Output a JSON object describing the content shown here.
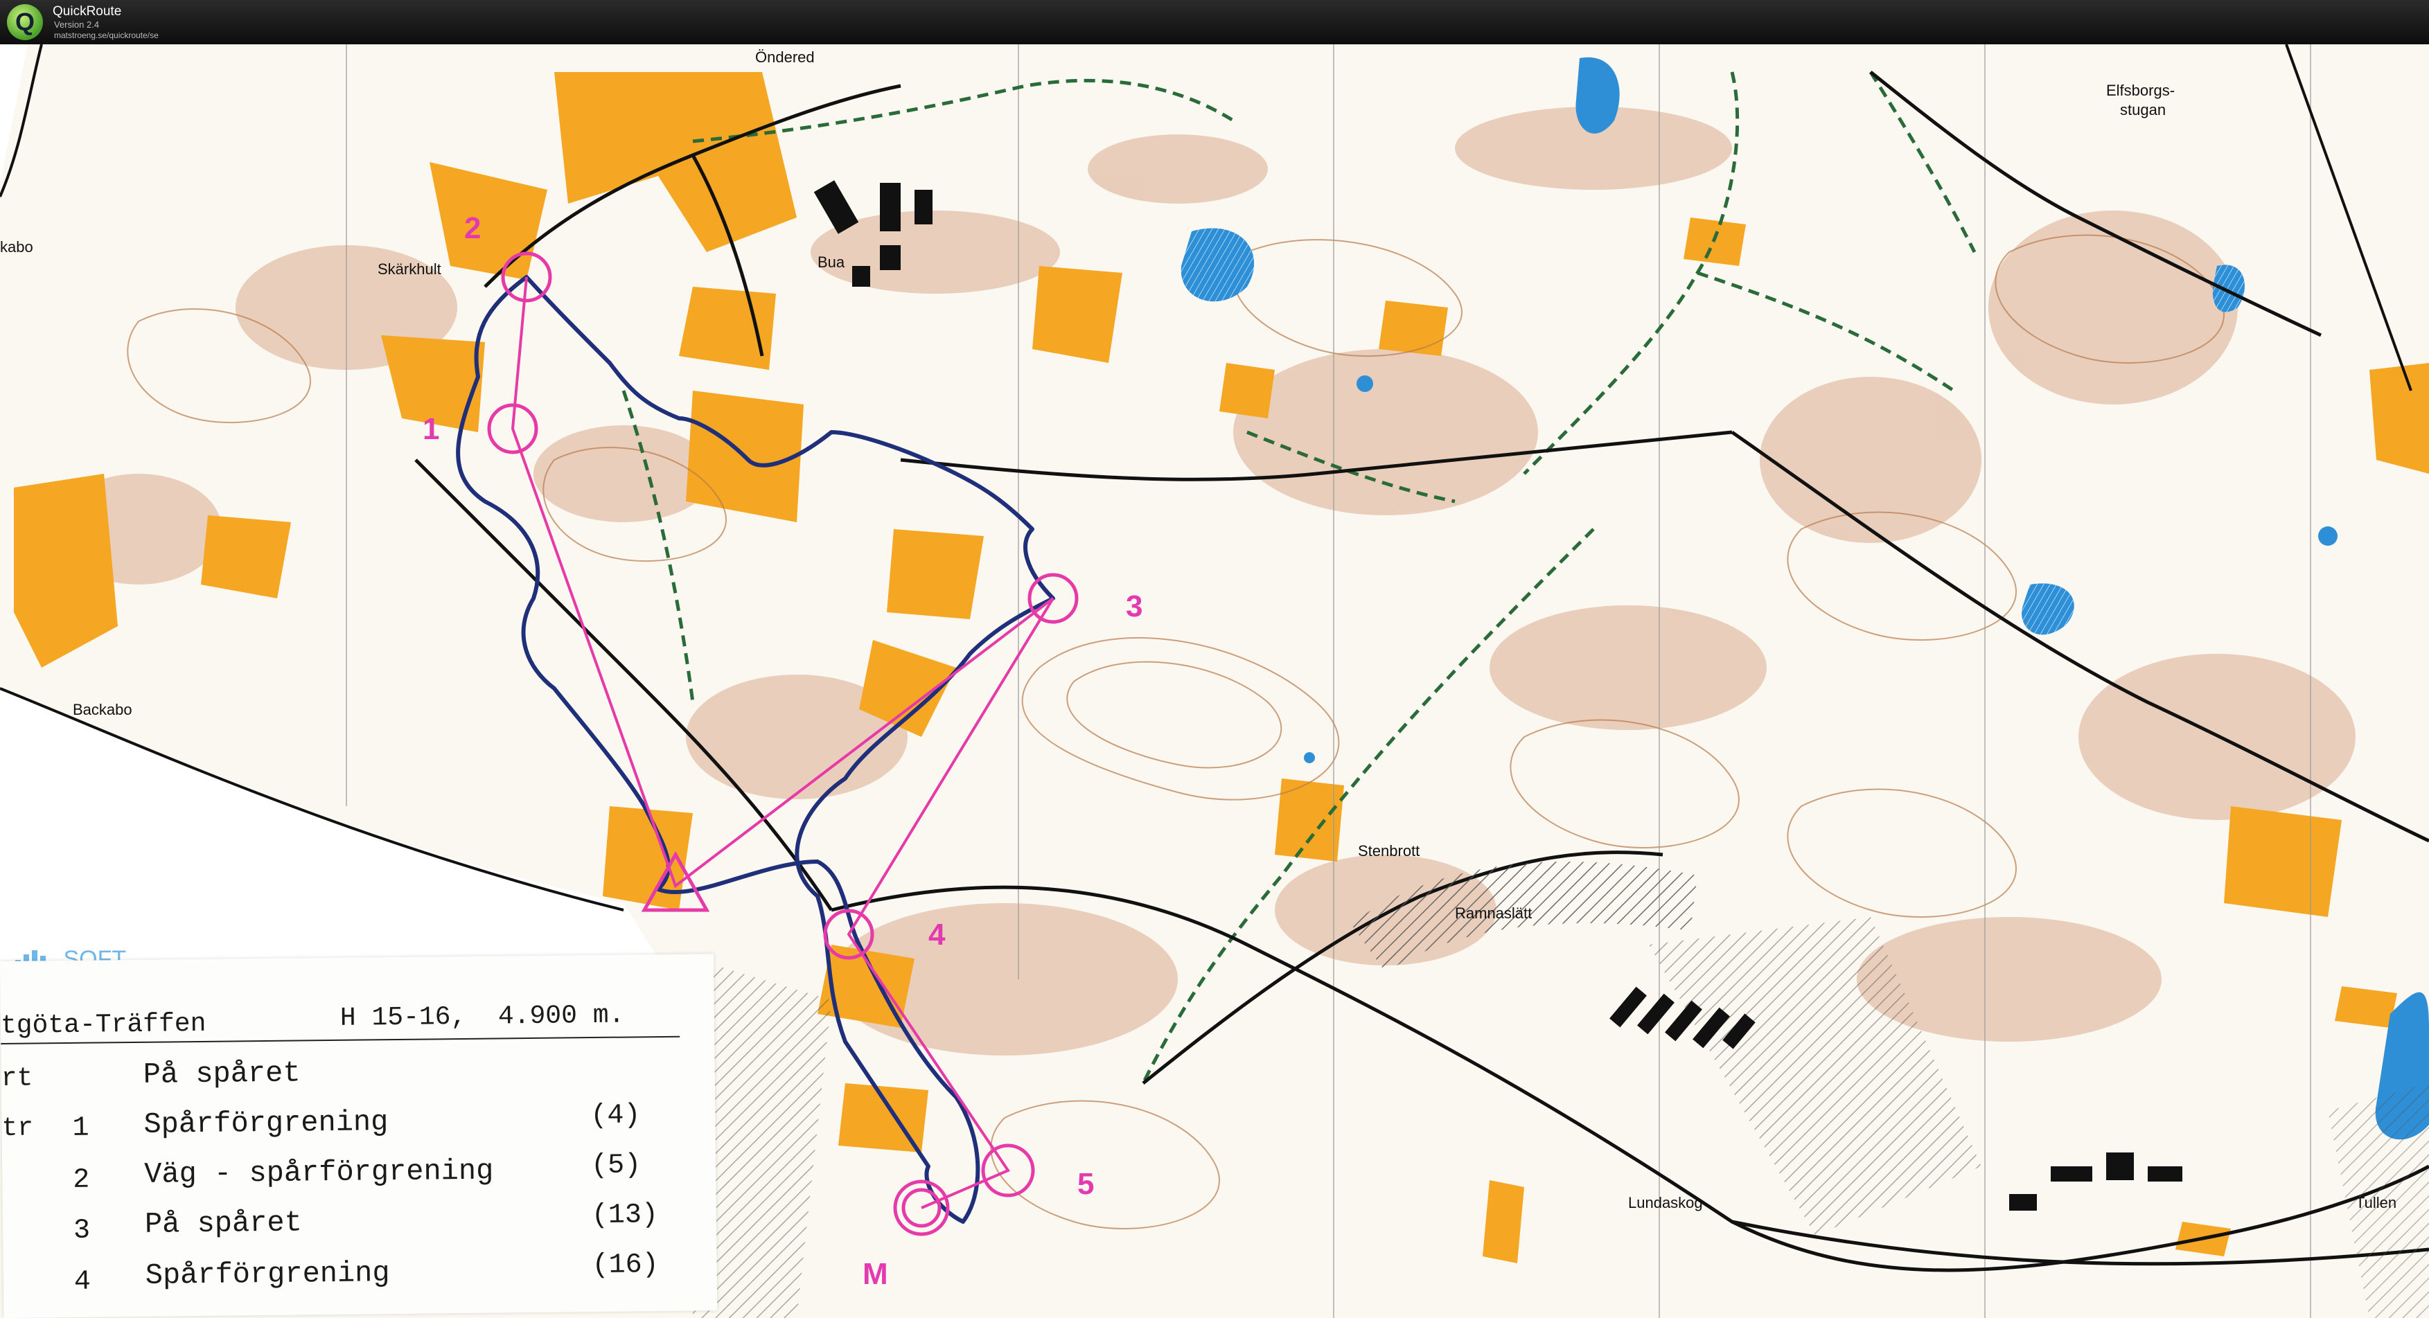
{
  "window": {
    "title": "QuickRoute",
    "version": "Version 2.4",
    "url": "matstroeng.se/quickroute/se",
    "icon": "quickroute-logo-icon"
  },
  "map": {
    "places": {
      "ondered": "Öndered",
      "skarkhult": "Skärkhult",
      "bua": "Bua",
      "kabo": "kabo",
      "backabo": "Backabo",
      "elfsborgs": "Elfsborgs-",
      "stugan": "stugan",
      "stenbrott": "Stenbrott",
      "ramnaslatt": "Ramnaslätt",
      "lundaskog": "Lundaskog",
      "tullen": "Tullen"
    },
    "controls": {
      "c1": "1",
      "c2": "2",
      "c3": "3",
      "c4": "4",
      "c5": "5",
      "finish": "M"
    },
    "colors": {
      "paper": "#fbf8f1",
      "open_land": "#f5a623",
      "rough": "#e7c9b5",
      "water": "#2f8fd6",
      "contour": "#b87a4a",
      "course": "#e63aa8",
      "route": "#1f2f7a",
      "trail": "#2a6b3a"
    },
    "logo": "SOFT"
  },
  "legend": {
    "event_name": "tgöta-Träffen",
    "class_length": "H 15-16,  4.900 m.",
    "rows": [
      {
        "code": "rt",
        "num": "",
        "desc": "På spåret",
        "code_no": ""
      },
      {
        "code": "tr",
        "num": "1",
        "desc": "Spårförgrening",
        "code_no": "(4)"
      },
      {
        "code": "",
        "num": "2",
        "desc": "Väg - spårförgrening",
        "code_no": "(5)"
      },
      {
        "code": "",
        "num": "3",
        "desc": "På spåret",
        "code_no": "(13)"
      },
      {
        "code": "",
        "num": "4",
        "desc": "Spårförgrening",
        "code_no": "(16)"
      }
    ]
  }
}
